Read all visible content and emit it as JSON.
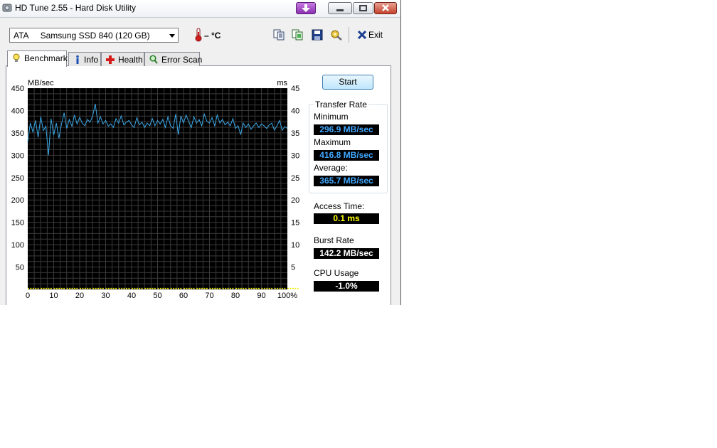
{
  "window": {
    "title": "HD Tune 2.55 - Hard Disk Utility"
  },
  "toolbar": {
    "drive": "ATA     Samsung SSD 840 (120 GB)",
    "temperature": "– °C",
    "exit_label": "Exit"
  },
  "tabs": [
    {
      "label": "Benchmark",
      "icon": "lightbulb-icon",
      "active": true
    },
    {
      "label": "Info",
      "icon": "info-icon",
      "active": false
    },
    {
      "label": "Health",
      "icon": "health-cross-icon",
      "active": false
    },
    {
      "label": "Error Scan",
      "icon": "magnifier-icon",
      "active": false
    }
  ],
  "stats": {
    "start_label": "Start",
    "transfer_rate_title": "Transfer Rate",
    "minimum_label": "Minimum",
    "minimum_value": "296.9 MB/sec",
    "maximum_label": "Maximum",
    "maximum_value": "416.8 MB/sec",
    "average_label": "Average:",
    "average_value": "365.7 MB/sec",
    "access_time_label": "Access Time:",
    "access_time_value": "0.1 ms",
    "burst_rate_label": "Burst Rate",
    "burst_rate_value": "142.2 MB/sec",
    "cpu_usage_label": "CPU Usage",
    "cpu_usage_value": "-1.0%"
  },
  "colors": {
    "plot_background": "#000000",
    "grid": "#3a3a3a",
    "transfer_line": "#3aa8e8",
    "access_points": "#f0f000",
    "value_text_blue": "#40a8ff"
  },
  "chart_data": {
    "type": "line",
    "ylabel_left": "MB/sec",
    "ylabel_right": "ms",
    "ylim_left": [
      0,
      450
    ],
    "ylim_right": [
      0,
      45
    ],
    "yticks_left": [
      50,
      100,
      150,
      200,
      250,
      300,
      350,
      400,
      450
    ],
    "yticks_right": [
      5,
      10,
      15,
      20,
      25,
      30,
      35,
      40,
      45
    ],
    "xlim": [
      0,
      100
    ],
    "xticks": [
      "0",
      "10",
      "20",
      "30",
      "40",
      "50",
      "60",
      "70",
      "80",
      "90",
      "100%"
    ],
    "grid": true,
    "series": [
      {
        "values_x": [
          0,
          1,
          2,
          3,
          4,
          5,
          6,
          7,
          8,
          9,
          10,
          11,
          12,
          13,
          14,
          15,
          16,
          17,
          18,
          19,
          20,
          21,
          22,
          23,
          24,
          25,
          26,
          27,
          28,
          29,
          30,
          31,
          32,
          33,
          34,
          35,
          36,
          37,
          38,
          39,
          40,
          41,
          42,
          43,
          44,
          45,
          46,
          47,
          48,
          49,
          50,
          51,
          52,
          53,
          54,
          55,
          56,
          57,
          58,
          59,
          60,
          61,
          62,
          63,
          64,
          65,
          66,
          67,
          68,
          69,
          70,
          71,
          72,
          73,
          74,
          75,
          76,
          77,
          78,
          79,
          80,
          81,
          82,
          83,
          84,
          85,
          86,
          87,
          88,
          89,
          90,
          91,
          92,
          93,
          94,
          95,
          96,
          97,
          98,
          99,
          100
        ],
        "values_y": [
          330,
          372,
          352,
          378,
          340,
          386,
          355,
          365,
          300,
          382,
          345,
          372,
          338,
          370,
          395,
          360,
          380,
          365,
          390,
          370,
          385,
          372,
          366,
          380,
          374,
          388,
          415,
          372,
          386,
          370,
          378,
          365,
          370,
          362,
          382,
          372,
          388,
          368,
          374,
          378,
          368,
          362,
          384,
          368,
          374,
          362,
          372,
          366,
          382,
          366,
          378,
          370,
          380,
          362,
          386,
          366,
          360,
          392,
          346,
          388,
          372,
          390,
          375,
          362,
          386,
          372,
          380,
          366,
          392,
          376,
          372,
          384,
          366,
          390,
          372,
          380,
          368,
          374,
          366,
          382,
          360,
          366,
          346,
          372,
          362,
          370,
          358,
          366,
          372,
          362,
          370,
          366,
          360,
          368,
          372,
          356,
          366,
          378,
          356,
          364,
          360
        ]
      },
      {
        "values_x": [
          0,
          5,
          10,
          15,
          20,
          25,
          30,
          35,
          40,
          45,
          50,
          55,
          60,
          65,
          70,
          75,
          80,
          85,
          90,
          95,
          100
        ],
        "values_y": [
          0.1,
          0.1,
          0.1,
          0.1,
          0.1,
          0.1,
          0.1,
          0.1,
          0.1,
          0.1,
          0.1,
          0.1,
          0.1,
          0.1,
          0.1,
          0.1,
          0.1,
          0.1,
          0.1,
          0.1,
          0.1
        ]
      }
    ]
  }
}
